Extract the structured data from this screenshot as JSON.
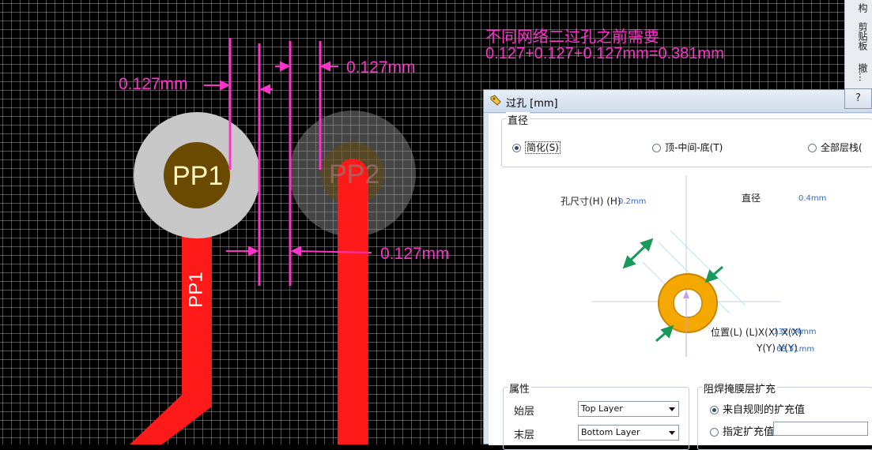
{
  "annotation": {
    "line1": "不同网络二过孔之前需要",
    "line2": "0.127+0.127+0.127mm=0.381mm"
  },
  "dimensions": {
    "left": "0.127mm",
    "right": "0.127mm",
    "bottom": "0.127mm"
  },
  "pads": {
    "pad1": "PP1",
    "pad2": "PP2",
    "trace_net": "PP1"
  },
  "side_strip": {
    "item1": "构",
    "item2": "剪贴板",
    "item3": "撤..."
  },
  "dialog": {
    "title": "过孔 [mm]",
    "help": "?",
    "diameter_group": {
      "title": "直径",
      "options": [
        "简化(S)",
        "顶-中间-底(T)",
        "全部层栈("
      ],
      "selected": 0
    },
    "preview": {
      "hole_size_label": "孔尺寸(H) (H)",
      "hole_size_value": "0.2mm",
      "diameter_label": "直径",
      "diameter_value": "0.4mm",
      "location_label": "位置(L) (L)X(X) X(X)",
      "x_value": "132.04mm",
      "y_label": "Y(Y) Y(Y)",
      "y_value": "68.51mm"
    },
    "properties_group": {
      "title": "属性",
      "start_layer_label": "始层",
      "start_layer_value": "Top Layer",
      "end_layer_label": "末层",
      "end_layer_value": "Bottom Layer"
    },
    "mask_group": {
      "title": "阻焊掩膜层扩充",
      "options": [
        "来自规则的扩充值",
        "指定扩充值"
      ],
      "selected": 0
    }
  },
  "colors": {
    "annotation": "#ff33cc",
    "trace": "#ff1a1a",
    "pad_copper": "#c8c8c8",
    "hole": "#6a4a00",
    "via_ring": "#f5a800"
  }
}
